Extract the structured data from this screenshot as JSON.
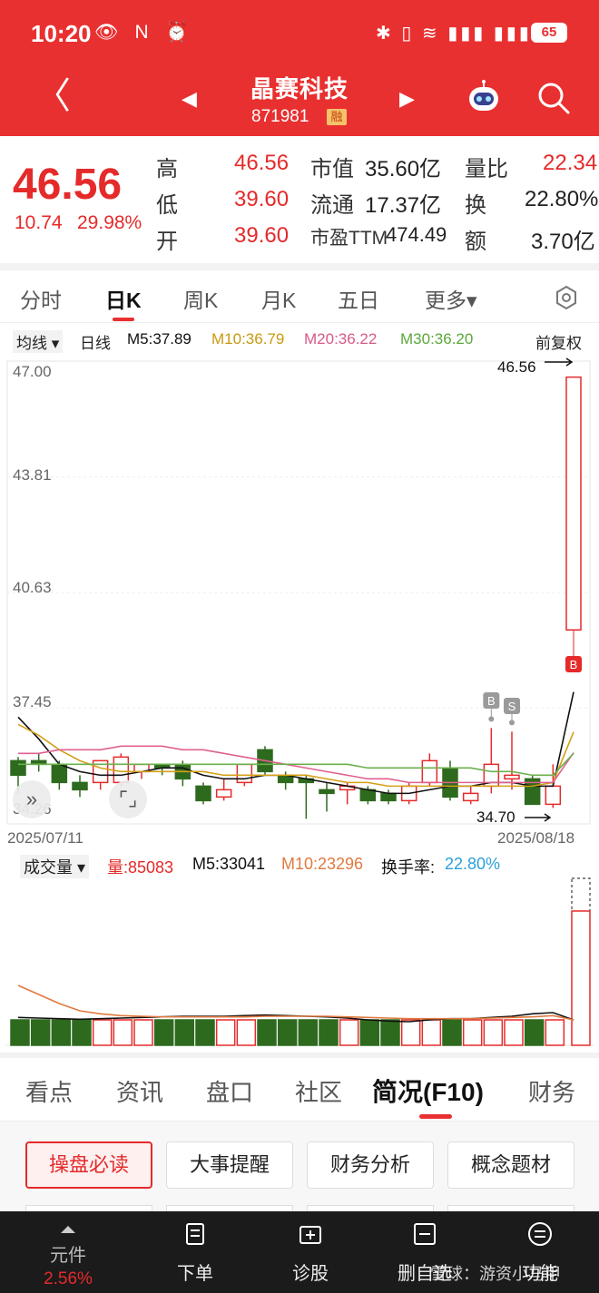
{
  "status_bar": {
    "time": "10:20",
    "left_icons": "👁 N ⏰",
    "right_icons": "✱ ▯ ≋ ▮▮▮ ▮▮▮",
    "battery": "65"
  },
  "header": {
    "back_icon": "chevron-left-icon",
    "stock_name": "晶赛科技",
    "stock_code": "871981",
    "badge": "融",
    "prev_glyph": "◀",
    "next_glyph": "▶",
    "back_glyph": "〈"
  },
  "quote": {
    "price": "46.56",
    "change": "10.74",
    "change_pct": "29.98%",
    "rows": [
      {
        "label1": "高",
        "val1": "46.56",
        "label2": "市值",
        "val2": "35.60亿",
        "label3": "量比",
        "val3": "22.34"
      },
      {
        "label1": "低",
        "val1": "39.60",
        "label2": "流通",
        "val2": "17.37亿",
        "label3": "换",
        "val3": "22.80%"
      },
      {
        "label1": "开",
        "val1": "39.60",
        "label2": "市盈TTM",
        "val2": "474.49",
        "label3": "额",
        "val3": "3.70亿"
      }
    ]
  },
  "period_tabs": [
    "分时",
    "日K",
    "周K",
    "月K",
    "五日",
    "更多▾"
  ],
  "ma_legend": {
    "selector": "均线 ▾",
    "type": "日线",
    "m5": "M5:37.89",
    "m10": "M10:36.79",
    "m20": "M20:36.22",
    "m30": "M30:36.20",
    "adjust": "前复权"
  },
  "colors": {
    "up": "#e52a2a",
    "down": "#2e6a1e",
    "m5": "#111111",
    "m10": "#d4a017",
    "m20": "#e06090",
    "m30": "#6ab04c",
    "vol_m10": "#e07a40",
    "turnover": "#2aa0d8"
  },
  "chart": {
    "y_ticks": [
      "47.00",
      "43.81",
      "40.63",
      "37.45",
      "34.26"
    ],
    "high_label": "46.56",
    "low_label": "34.70",
    "start_date": "2025/07/11",
    "end_date": "2025/08/18",
    "markers": [
      "B",
      "S",
      "B"
    ]
  },
  "volume_legend": {
    "selector": "成交量 ▾",
    "vol": "量:85083",
    "m5": "M5:33041",
    "m10": "M10:23296",
    "turnover_label": "换手率:",
    "turnover_value": "22.80%"
  },
  "chart_data": [
    {
      "type": "candlestick",
      "title": "",
      "x": [
        "2025/07/11",
        "2025/08/18"
      ],
      "ylim": [
        34.26,
        47.0
      ],
      "candles": [
        {
          "open": 36.0,
          "close": 35.6,
          "high": 36.1,
          "low": 35.1
        },
        {
          "open": 36.0,
          "close": 35.9,
          "high": 36.2,
          "low": 35.7
        },
        {
          "open": 35.9,
          "close": 35.4,
          "high": 36.0,
          "low": 35.2
        },
        {
          "open": 35.4,
          "close": 35.2,
          "high": 35.6,
          "low": 35.0
        },
        {
          "open": 35.4,
          "close": 36.0,
          "high": 36.0,
          "low": 35.2
        },
        {
          "open": 35.4,
          "close": 36.1,
          "high": 36.2,
          "low": 35.3
        },
        {
          "open": 35.7,
          "close": 35.9,
          "high": 35.9,
          "low": 35.5
        },
        {
          "open": 35.9,
          "close": 35.8,
          "high": 35.9,
          "low": 35.6
        },
        {
          "open": 35.9,
          "close": 35.5,
          "high": 36.0,
          "low": 35.3
        },
        {
          "open": 35.3,
          "close": 34.9,
          "high": 35.4,
          "low": 34.8
        },
        {
          "open": 35.0,
          "close": 35.2,
          "high": 35.5,
          "low": 34.9
        },
        {
          "open": 35.4,
          "close": 35.9,
          "high": 35.9,
          "low": 35.3
        },
        {
          "open": 36.3,
          "close": 35.7,
          "high": 36.4,
          "low": 35.6
        },
        {
          "open": 35.6,
          "close": 35.4,
          "high": 35.7,
          "low": 35.2
        },
        {
          "open": 35.5,
          "close": 35.4,
          "high": 35.6,
          "low": 34.4
        },
        {
          "open": 35.2,
          "close": 35.1,
          "high": 35.4,
          "low": 34.6
        },
        {
          "open": 35.2,
          "close": 35.3,
          "high": 35.4,
          "low": 34.8
        },
        {
          "open": 35.2,
          "close": 34.9,
          "high": 35.3,
          "low": 34.8
        },
        {
          "open": 35.1,
          "close": 34.9,
          "high": 35.2,
          "low": 34.8
        },
        {
          "open": 34.9,
          "close": 35.3,
          "high": 35.4,
          "low": 34.8
        },
        {
          "open": 35.4,
          "close": 36.0,
          "high": 36.2,
          "low": 35.3
        },
        {
          "open": 35.8,
          "close": 35.0,
          "high": 36.0,
          "low": 34.9
        },
        {
          "open": 34.9,
          "close": 35.1,
          "high": 35.3,
          "low": 34.8
        },
        {
          "open": 35.3,
          "close": 35.9,
          "high": 36.9,
          "low": 35.1
        },
        {
          "open": 35.5,
          "close": 35.6,
          "high": 36.8,
          "low": 35.2
        },
        {
          "open": 35.5,
          "close": 34.8,
          "high": 35.6,
          "low": 34.8
        },
        {
          "open": 34.8,
          "close": 35.3,
          "high": 35.9,
          "low": 34.7
        },
        {
          "open": 39.6,
          "close": 46.56,
          "high": 46.56,
          "low": 39.6
        }
      ],
      "series": [
        {
          "name": "M5",
          "values": [
            37.2,
            36.6,
            35.9,
            35.7,
            35.6,
            35.6,
            35.7,
            35.8,
            35.8,
            35.6,
            35.5,
            35.5,
            35.6,
            35.6,
            35.5,
            35.4,
            35.3,
            35.2,
            35.1,
            35.1,
            35.2,
            35.3,
            35.3,
            35.4,
            35.4,
            35.3,
            35.3,
            37.89
          ]
        },
        {
          "name": "M10",
          "values": [
            37.0,
            36.7,
            36.3,
            36.0,
            35.8,
            35.7,
            35.7,
            35.7,
            35.7,
            35.7,
            35.6,
            35.6,
            35.6,
            35.6,
            35.6,
            35.5,
            35.4,
            35.4,
            35.3,
            35.3,
            35.3,
            35.3,
            35.3,
            35.3,
            35.3,
            35.3,
            35.4,
            36.79
          ]
        },
        {
          "name": "M20",
          "values": [
            36.2,
            36.2,
            36.3,
            36.3,
            36.3,
            36.4,
            36.4,
            36.4,
            36.3,
            36.3,
            36.2,
            36.1,
            36.0,
            35.9,
            35.8,
            35.7,
            35.6,
            35.5,
            35.5,
            35.4,
            35.4,
            35.4,
            35.4,
            35.4,
            35.4,
            35.4,
            35.4,
            36.22
          ]
        },
        {
          "name": "M30",
          "values": [
            35.9,
            35.9,
            35.9,
            35.9,
            35.9,
            35.9,
            35.9,
            35.9,
            35.9,
            35.9,
            35.9,
            35.9,
            35.9,
            35.9,
            35.9,
            35.9,
            35.9,
            35.8,
            35.8,
            35.8,
            35.8,
            35.8,
            35.8,
            35.7,
            35.7,
            35.6,
            35.6,
            36.2
          ]
        }
      ]
    },
    {
      "type": "bar",
      "title": "",
      "values": [
        3800,
        3000,
        3600,
        2500,
        5600,
        3900,
        3700,
        4100,
        4100,
        3400,
        4300,
        4600,
        4300,
        4100,
        3600,
        2400,
        2200,
        2100,
        3000,
        3200,
        6300,
        3600,
        2600,
        5800,
        3800,
        4900,
        5400,
        85083
      ],
      "series": [
        {
          "name": "M5",
          "values": [
            3700,
            3600,
            3500,
            3400,
            3500,
            3600,
            3700,
            3800,
            3900,
            3900,
            3900,
            4000,
            4100,
            4000,
            3900,
            3800,
            3600,
            3300,
            3100,
            3000,
            3300,
            3500,
            3500,
            3700,
            3900,
            4300,
            4500,
            33041
          ]
        },
        {
          "name": "M10",
          "values": [
            9000,
            7500,
            6000,
            4800,
            4300,
            4000,
            3900,
            3800,
            3800,
            3800,
            3800,
            3800,
            3900,
            3900,
            3900,
            3900,
            3800,
            3700,
            3600,
            3500,
            3500,
            3500,
            3500,
            3600,
            3700,
            3800,
            4000,
            23296
          ]
        }
      ]
    }
  ],
  "bottom_tabs": [
    "看点",
    "资讯",
    "盘口",
    "社区",
    "简况(F10)",
    "财务"
  ],
  "chips": [
    "操盘必读",
    "大事提醒",
    "财务分析",
    "概念题材"
  ],
  "bottom_bar": [
    {
      "label": "元件",
      "sub": "2.56%",
      "icon": "chevron-up-icon"
    },
    {
      "label": "下单",
      "icon": "order-icon"
    },
    {
      "label": "诊股",
      "icon": "diagnose-icon"
    },
    {
      "label": "删自选",
      "icon": "remove-watchlist-icon"
    },
    {
      "label": "功能",
      "icon": "menu-icon"
    }
  ],
  "watermark": "雪球：游资小马甲"
}
